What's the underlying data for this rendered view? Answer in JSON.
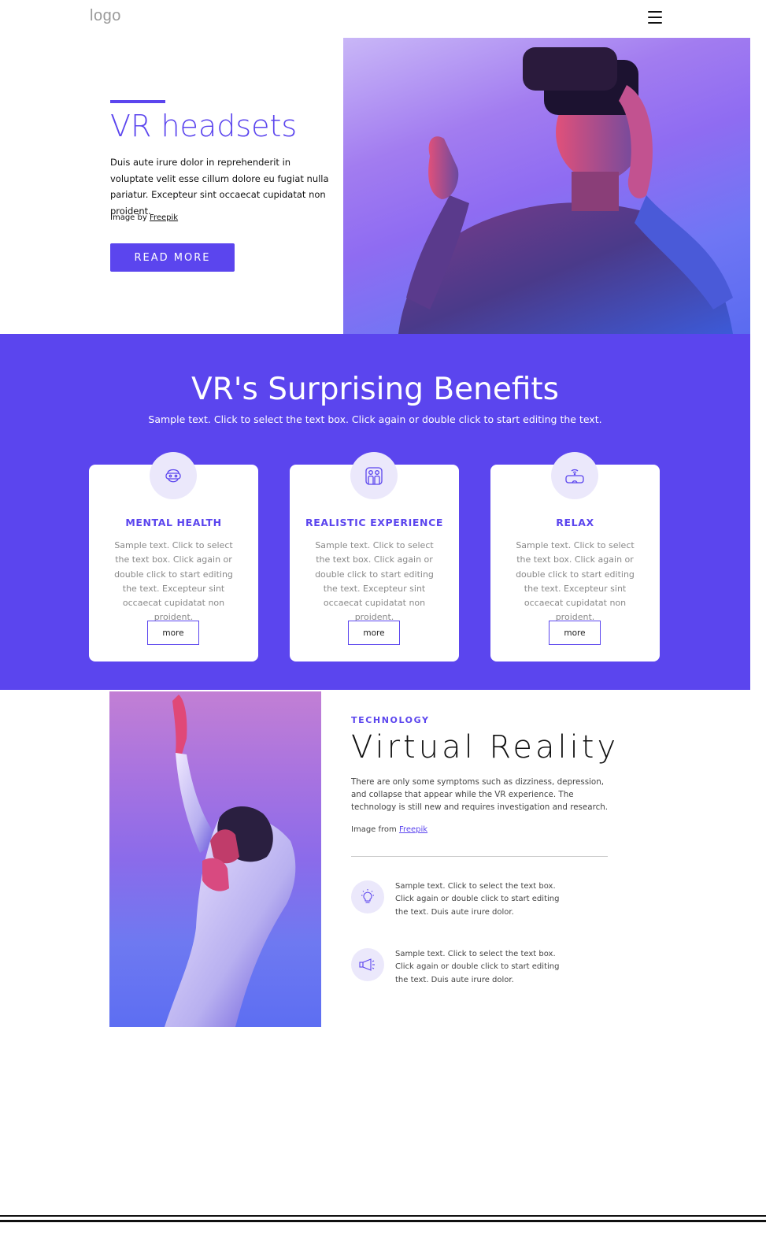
{
  "header": {
    "logo": "logo",
    "menu_icon": "hamburger-menu-icon"
  },
  "hero": {
    "title": "VR headsets",
    "text": "Duis aute irure dolor in reprehenderit in voluptate velit esse cillum dolore eu fugiat nulla pariatur. Excepteur sint occaecat cupidatat non proident.",
    "credit_prefix": "Image by ",
    "credit_link": "Freepik",
    "button": "READ MORE",
    "accent_color": "#5b45ee"
  },
  "benefits": {
    "title": "VR's Surprising Benefits",
    "subtitle": "Sample text. Click to select the text box. Click again or double click to start editing the text.",
    "background_color": "#5b45ee",
    "cards": [
      {
        "icon": "vr-head-icon",
        "title": "MENTAL HEALTH",
        "text": "Sample text. Click to select the text box. Click again or double click to start editing the text. Excepteur sint occaecat cupidatat non proident.",
        "button": "more"
      },
      {
        "icon": "vr-people-icon",
        "title": "REALISTIC EXPERIENCE",
        "text": "Sample text. Click to select the text box. Click again or double click to start editing the text. Excepteur sint occaecat cupidatat non proident.",
        "button": "more"
      },
      {
        "icon": "vr-goggles-wifi-icon",
        "title": "RELAX",
        "text": "Sample text. Click to select the text box. Click again or double click to start editing the text. Excepteur sint occaecat cupidatat non proident.",
        "button": "more"
      }
    ]
  },
  "tech": {
    "label": "TECHNOLOGY",
    "title": "Virtual Reality",
    "text": "There are only some symptoms such as dizziness, depression, and collapse that appear while the VR experience. The technology is still new and requires investigation and research.",
    "credit_prefix": "Image from ",
    "credit_link": "Freepik",
    "features": [
      {
        "icon": "lightbulb-icon",
        "text": "Sample text. Click to select the text box. Click again or double click to start editing the text. Duis aute irure dolor."
      },
      {
        "icon": "megaphone-icon",
        "text": "Sample text. Click to select the text box. Click again or double click to start editing the text. Duis aute irure dolor."
      }
    ]
  }
}
